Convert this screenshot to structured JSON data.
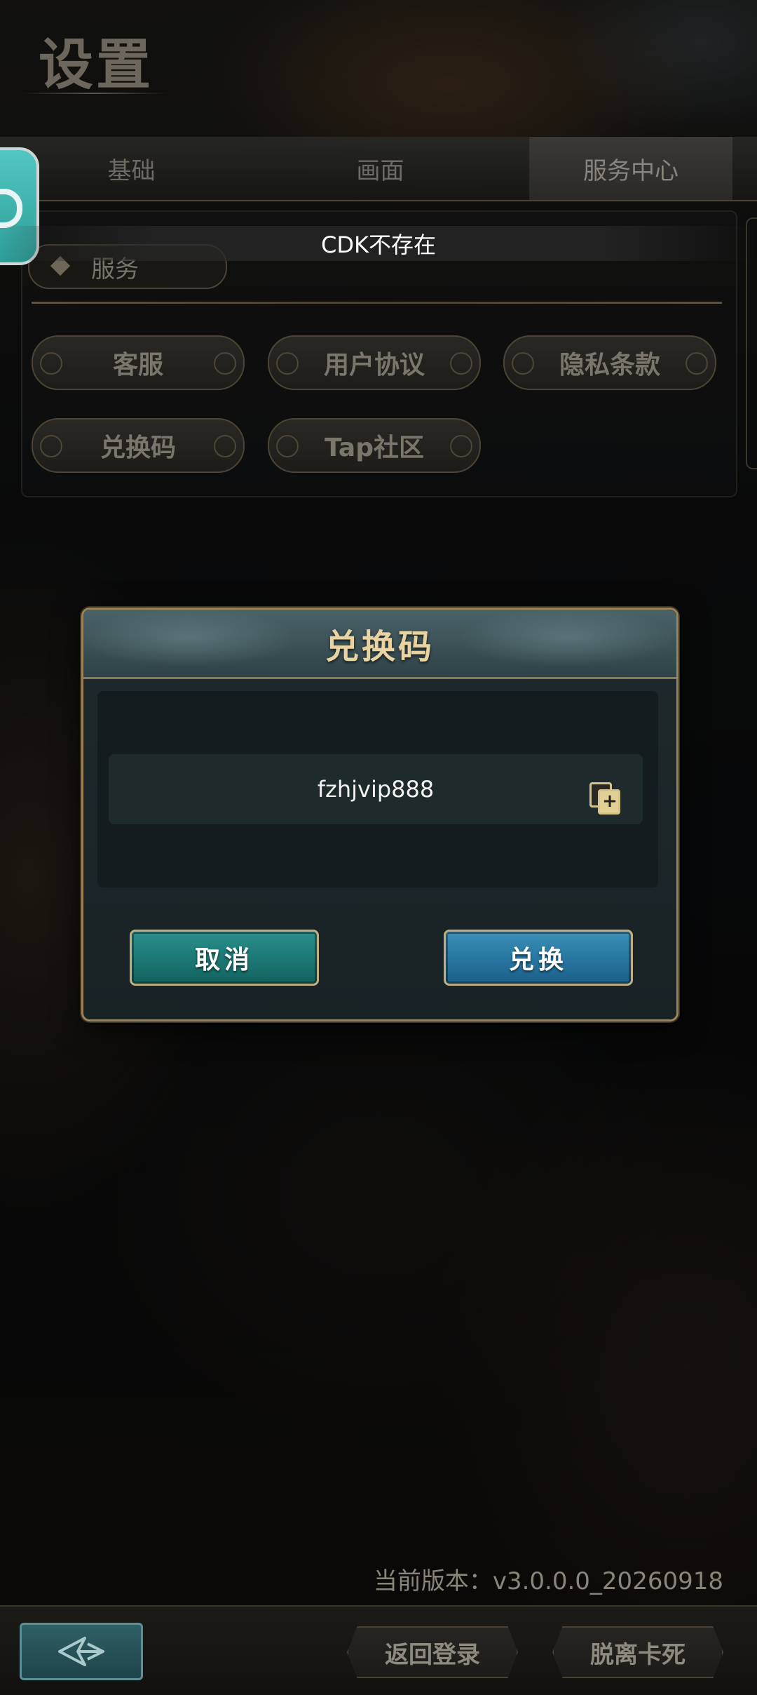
{
  "header": {
    "title": "设置"
  },
  "tabs": [
    {
      "label": "基础",
      "active": false
    },
    {
      "label": "画面",
      "active": false
    },
    {
      "label": "服务中心",
      "active": true
    }
  ],
  "toast": {
    "message": "CDK不存在"
  },
  "service": {
    "section_label": "服务",
    "buttons": [
      "客服",
      "用户协议",
      "隐私条款",
      "兑换码",
      "Tap社区"
    ]
  },
  "dialog": {
    "title": "兑换码",
    "code_value": "fzhjvip888",
    "cancel_label": "取消",
    "confirm_label": "兑换"
  },
  "footer": {
    "version_label": "当前版本：v3.0.0.0_20260918",
    "return_login_label": "返回登录",
    "unstuck_label": "脱离卡死"
  },
  "colors": {
    "accent_gold": "#9a8458",
    "cancel_teal": "#1e7b78",
    "confirm_blue": "#2a7aa5"
  },
  "icons": [
    "app-float-icon",
    "service-diamond-icon",
    "paste-icon",
    "back-arrow-icon"
  ]
}
